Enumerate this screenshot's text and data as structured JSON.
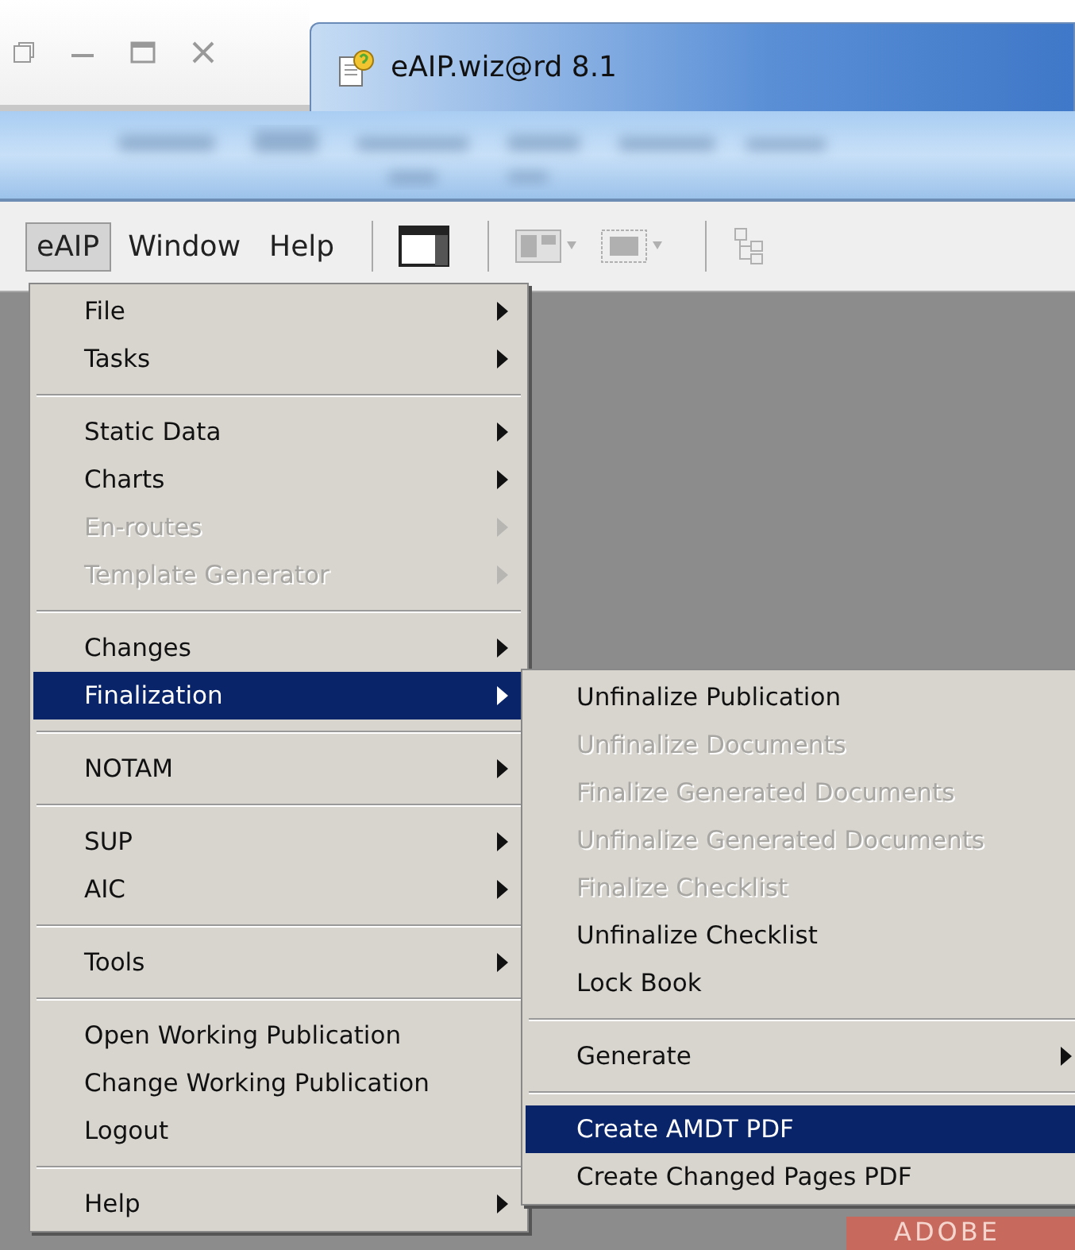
{
  "window": {
    "title": "eAIP.wiz@rd 8.1"
  },
  "menubar": [
    {
      "label": "eAIP",
      "selected": true
    },
    {
      "label": "Window",
      "selected": false
    },
    {
      "label": "Help",
      "selected": false
    }
  ],
  "toolbar": [
    {
      "kind": "panel",
      "disabled": false
    },
    {
      "kind": "grid",
      "disabled": true
    },
    {
      "kind": "frame",
      "disabled": true
    },
    {
      "kind": "tree",
      "disabled": true
    }
  ],
  "menu": {
    "groups": [
      [
        {
          "label": "File",
          "disabled": false,
          "submenu": true,
          "selected": false
        },
        {
          "label": "Tasks",
          "disabled": false,
          "submenu": true,
          "selected": false
        }
      ],
      [
        {
          "label": "Static Data",
          "disabled": false,
          "submenu": true,
          "selected": false
        },
        {
          "label": "Charts",
          "disabled": false,
          "submenu": true,
          "selected": false
        },
        {
          "label": "En-routes",
          "disabled": true,
          "submenu": true,
          "selected": false
        },
        {
          "label": "Template Generator",
          "disabled": true,
          "submenu": true,
          "selected": false
        }
      ],
      [
        {
          "label": "Changes",
          "disabled": false,
          "submenu": true,
          "selected": false
        },
        {
          "label": "Finalization",
          "disabled": false,
          "submenu": true,
          "selected": true
        }
      ],
      [
        {
          "label": "NOTAM",
          "disabled": false,
          "submenu": true,
          "selected": false
        }
      ],
      [
        {
          "label": "SUP",
          "disabled": false,
          "submenu": true,
          "selected": false
        },
        {
          "label": "AIC",
          "disabled": false,
          "submenu": true,
          "selected": false
        }
      ],
      [
        {
          "label": "Tools",
          "disabled": false,
          "submenu": true,
          "selected": false
        }
      ],
      [
        {
          "label": "Open Working Publication",
          "disabled": false,
          "submenu": false,
          "selected": false
        },
        {
          "label": "Change Working Publication",
          "disabled": false,
          "submenu": false,
          "selected": false
        },
        {
          "label": "Logout",
          "disabled": false,
          "submenu": false,
          "selected": false
        }
      ],
      [
        {
          "label": "Help",
          "disabled": false,
          "submenu": true,
          "selected": false
        }
      ]
    ]
  },
  "submenu": {
    "groups": [
      [
        {
          "label": "Unfinalize Publication",
          "disabled": false,
          "submenu": false,
          "selected": false
        },
        {
          "label": "Unfinalize Documents",
          "disabled": true,
          "submenu": false,
          "selected": false
        },
        {
          "label": "Finalize Generated Documents",
          "disabled": true,
          "submenu": false,
          "selected": false
        },
        {
          "label": "Unfinalize Generated Documents",
          "disabled": true,
          "submenu": false,
          "selected": false
        },
        {
          "label": "Finalize Checklist",
          "disabled": true,
          "submenu": false,
          "selected": false
        },
        {
          "label": "Unfinalize Checklist",
          "disabled": false,
          "submenu": false,
          "selected": false
        },
        {
          "label": "Lock Book",
          "disabled": false,
          "submenu": false,
          "selected": false
        }
      ],
      [
        {
          "label": "Generate",
          "disabled": false,
          "submenu": true,
          "selected": false
        }
      ],
      [
        {
          "label": "Create AMDT PDF",
          "disabled": false,
          "submenu": false,
          "selected": true
        },
        {
          "label": "Create Changed Pages PDF",
          "disabled": false,
          "submenu": false,
          "selected": false
        }
      ]
    ]
  },
  "banner": {
    "text": "ADOBE"
  }
}
